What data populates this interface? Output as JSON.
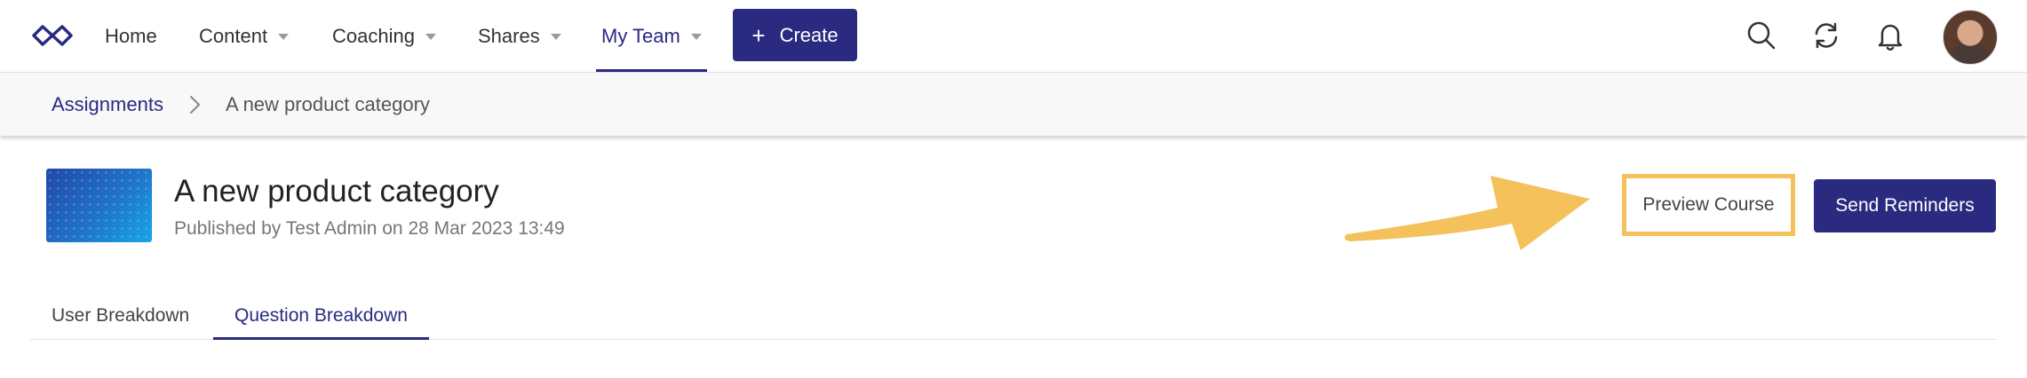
{
  "nav": {
    "logo_icon": "infinity-logo-icon",
    "items": [
      {
        "label": "Home",
        "has_caret": false
      },
      {
        "label": "Content",
        "has_caret": true
      },
      {
        "label": "Coaching",
        "has_caret": true
      },
      {
        "label": "Shares",
        "has_caret": true
      },
      {
        "label": "My Team",
        "has_caret": true,
        "active": true
      }
    ],
    "create_label": "Create",
    "icons": [
      "search-icon",
      "sync-icon",
      "bell-icon"
    ],
    "avatar": "user-avatar"
  },
  "breadcrumb": {
    "parent": "Assignments",
    "current": "A new product category"
  },
  "assignment": {
    "title": "A new product category",
    "subtitle": "Published by Test Admin on 28 Mar 2023 13:49"
  },
  "actions": {
    "preview_label": "Preview Course",
    "send_label": "Send Reminders"
  },
  "tabs": [
    {
      "label": "User Breakdown",
      "active": false
    },
    {
      "label": "Question Breakdown",
      "active": true
    }
  ],
  "colors": {
    "brand": "#2a2a80",
    "highlight": "#f4c15b"
  }
}
